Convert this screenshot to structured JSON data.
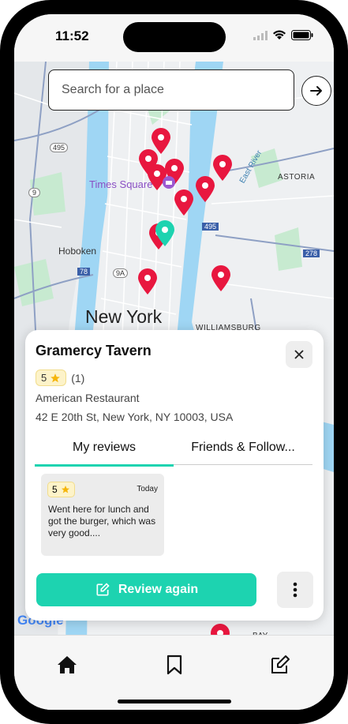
{
  "status_bar": {
    "time": "11:52"
  },
  "search": {
    "placeholder": "Search for a place"
  },
  "map": {
    "labels": {
      "times_square": "Times Square",
      "astoria": "ASTORIA",
      "east_river": "East River",
      "hoboken": "Hoboken",
      "new_york": "New York",
      "williamsburg": "WILLIAMSBURG",
      "bay": "BAY",
      "route_495a": "495",
      "route_495b": "495",
      "route_9": "9",
      "route_78": "78",
      "route_9a": "9A",
      "route_278": "278"
    },
    "attribution": "Google",
    "pin_color": "#e8173f",
    "selected_pin_color": "#1dd3b0"
  },
  "place_card": {
    "name": "Gramercy Tavern",
    "rating": "5",
    "rating_count": "(1)",
    "category": "American Restaurant",
    "address": "42 E 20th St, New York, NY 10003, USA",
    "tabs": [
      "My reviews",
      "Friends & Follow..."
    ],
    "active_tab": 0,
    "review": {
      "rating": "5",
      "date": "Today",
      "text": "Went here for lunch and got the burger, which was very good...."
    },
    "review_again_label": "Review again",
    "accent_color": "#1dd3b0"
  },
  "tab_bar": {
    "items": [
      "home-icon",
      "bookmark-icon",
      "edit-icon"
    ]
  }
}
